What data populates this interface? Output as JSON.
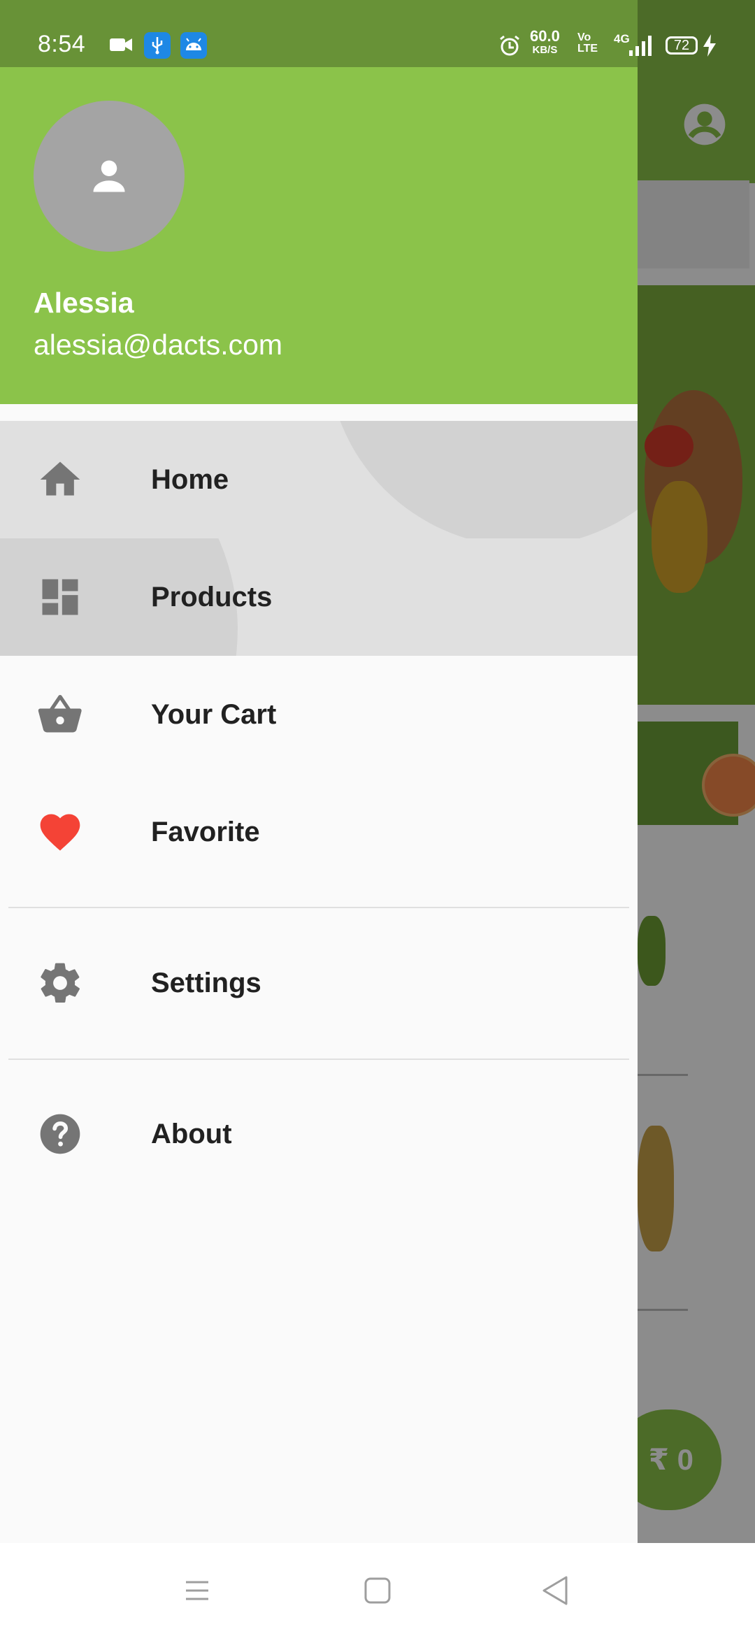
{
  "status_bar": {
    "time": "8:54",
    "net_rate": "60.0",
    "net_unit": "KB/S",
    "volte": "Vo LTE",
    "network": "4G",
    "battery": "72",
    "icons": [
      "video-camera-icon",
      "usb-icon",
      "android-icon",
      "alarm-icon",
      "signal-icon",
      "charging-icon"
    ]
  },
  "background_app": {
    "cart_total": "₹ 0",
    "icons": [
      "account-circle-icon",
      "video-record-icon"
    ]
  },
  "drawer": {
    "header": {
      "account_name": "Alessia",
      "account_email": "alessia@dacts.com",
      "avatar_icon": "person-icon",
      "color": "#8bc34a"
    },
    "items": [
      {
        "label": "Home",
        "icon": "home-icon"
      },
      {
        "label": "Products",
        "icon": "dashboard-icon"
      },
      {
        "label": "Your Cart",
        "icon": "shopping-basket-icon"
      },
      {
        "label": "Favorite",
        "icon": "heart-icon",
        "icon_color": "#f44336"
      },
      {
        "label": "Settings",
        "icon": "settings-gear-icon"
      },
      {
        "label": "About",
        "icon": "help-icon"
      }
    ]
  },
  "nav_bar": {
    "buttons": [
      "menu-nav-button",
      "home-nav-button",
      "back-nav-button"
    ]
  }
}
